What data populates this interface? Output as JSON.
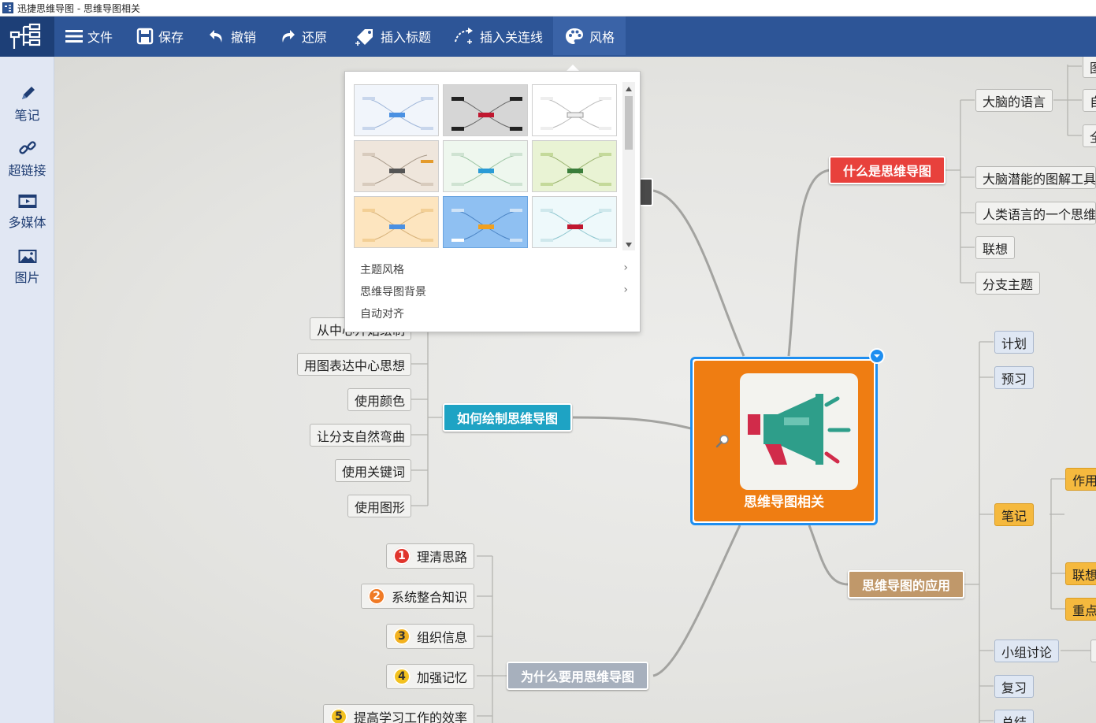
{
  "window": {
    "title": "迅捷思维导图 - 思维导图相关"
  },
  "toolbar": {
    "file": "文件",
    "save": "保存",
    "undo": "撤销",
    "redo": "还原",
    "insert_topic": "插入标题",
    "insert_connector": "插入关连线",
    "style": "风格"
  },
  "sidebar": {
    "notes": "笔记",
    "hyperlink": "超链接",
    "multimedia": "多媒体",
    "image": "图片"
  },
  "style_menu": {
    "theme_style": "主题风格",
    "background": "思维导图背景",
    "auto_align": "自动对齐",
    "submenu_arrow": "›"
  },
  "mindmap": {
    "center": "思维导图相关",
    "what": {
      "label": "什么是思维导图",
      "color": "#e8413c",
      "children": [
        "大脑的语言",
        "大脑潜能的图解工具",
        "人类语言的一个思维",
        "联想",
        "分支主题"
      ],
      "edge_tags": [
        "图",
        "自",
        "全"
      ]
    },
    "how": {
      "label": "如何绘制思维导图",
      "color": "#1ea3c4",
      "children": [
        "从中心开始绘制",
        "用图表达中心思想",
        "使用颜色",
        "让分支自然弯曲",
        "使用关键词",
        "使用图形"
      ]
    },
    "why": {
      "label": "为什么要用思维导图",
      "color": "#a7b0bd",
      "children": [
        {
          "num": "1",
          "text": "理清思路",
          "color": "#e0342c"
        },
        {
          "num": "2",
          "text": "系统整合知识",
          "color": "#f07a25"
        },
        {
          "num": "3",
          "text": "组织信息",
          "color": "#f3b21f"
        },
        {
          "num": "4",
          "text": "加强记忆",
          "color": "#f3c21f"
        },
        {
          "num": "5",
          "text": "提高学习工作的效率",
          "color": "#f3c21f"
        }
      ]
    },
    "apply": {
      "label": "思维导图的应用",
      "color": "#c0986a",
      "children": [
        "计划",
        "预习",
        "笔记",
        "小组讨论",
        "复习",
        "总结"
      ],
      "notes_children": [
        "作用",
        "联想",
        "重点"
      ]
    }
  }
}
